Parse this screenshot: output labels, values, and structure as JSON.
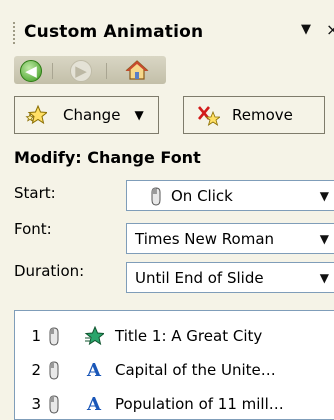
{
  "panel": {
    "title": "Custom Animation",
    "menu_arrow": "▼",
    "close_glyph": "×"
  },
  "nav": {
    "back_icon": "back-arrow",
    "forward_icon": "forward-arrow",
    "home_icon": "home"
  },
  "toolbar": {
    "change_label": "Change",
    "remove_label": "Remove"
  },
  "modify": {
    "header": "Modify: Change Font",
    "start_label": "Start:",
    "start_value": "On Click",
    "font_label": "Font:",
    "font_value": "Times New Roman",
    "duration_label": "Duration:",
    "duration_value": "Until End of Slide"
  },
  "animations": [
    {
      "num": "1",
      "text": "Title 1: A Great City",
      "effect": "star-effect"
    },
    {
      "num": "2",
      "text": "Capital of the Unite…",
      "effect": "font-a"
    },
    {
      "num": "3",
      "text": "Population of 11 mill…",
      "effect": "font-a"
    }
  ],
  "colors": {
    "panel_bg": "#f5f3e7",
    "field_border": "#7f9db9",
    "font_icon": "#1a57b8",
    "nav_back": "#3a9a1d"
  }
}
